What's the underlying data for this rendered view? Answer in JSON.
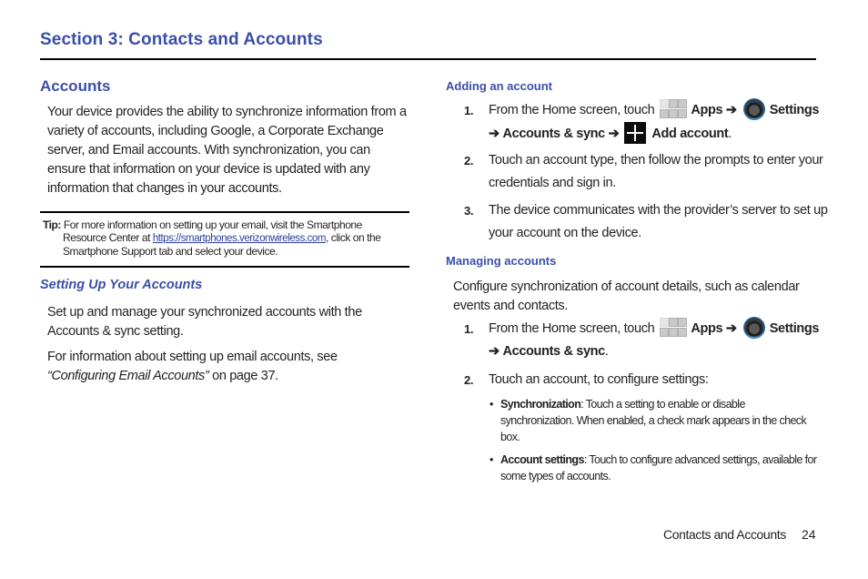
{
  "page": {
    "section_title": "Section 3: Contacts and Accounts",
    "footer": {
      "label": "Contacts and Accounts",
      "page_number": "24"
    }
  },
  "left": {
    "accounts_heading": "Accounts",
    "accounts_para": "Your device provides the ability to synchronize information from a variety of accounts, including Google, a Corporate Exchange server, and Email accounts. With synchronization, you can ensure that information on your device is updated with any information that changes in your accounts.",
    "tip": {
      "label": "Tip:",
      "text_before": " For more information on setting up your email, visit the Smartphone",
      "line2_before": "Resource Center at ",
      "link": "https://smartphones.verizonwireless.com",
      "line2_after": ", click on the",
      "line3": "Smartphone Support tab and select your device."
    },
    "setup_heading": "Setting Up Your Accounts",
    "setup_para1": "Set up and manage your synchronized accounts with the Accounts & sync setting.",
    "setup_para2_before": "For information about setting up email accounts, see",
    "setup_para2_ref": "“Configuring Email Accounts”",
    "setup_para2_after": " on page 37."
  },
  "right": {
    "adding_heading": "Adding an account",
    "adding_steps": [
      {
        "num": "1.",
        "text_before": "From the Home screen, touch",
        "apps": "Apps",
        "arrow": "➔",
        "settings": "Settings",
        "accounts_sync": "Accounts & sync",
        "add_account": "Add account",
        "end": "."
      },
      {
        "num": "2.",
        "text": "Touch an account type, then follow the prompts to enter your credentials and sign in."
      },
      {
        "num": "3.",
        "text": "The device communicates with the provider’s server to set up your account on the device."
      }
    ],
    "managing_heading": "Managing accounts",
    "managing_para": "Configure synchronization of account details, such as calendar events and contacts.",
    "managing_steps": [
      {
        "num": "1.",
        "text_before": "From the Home screen, touch",
        "apps": "Apps",
        "arrow": "➔",
        "settings": "Settings",
        "accounts_sync": "Accounts & sync",
        "end": "."
      },
      {
        "num": "2.",
        "text": "Touch an account, to configure settings:"
      }
    ],
    "bullets": [
      {
        "term": "Synchronization",
        "text": ": Touch a setting to enable or disable synchronization. When enabled, a check mark appears in the check box."
      },
      {
        "term": "Account settings",
        "text": ": Touch to configure advanced settings, available for some types of accounts."
      }
    ],
    "bullet_char": "•"
  }
}
